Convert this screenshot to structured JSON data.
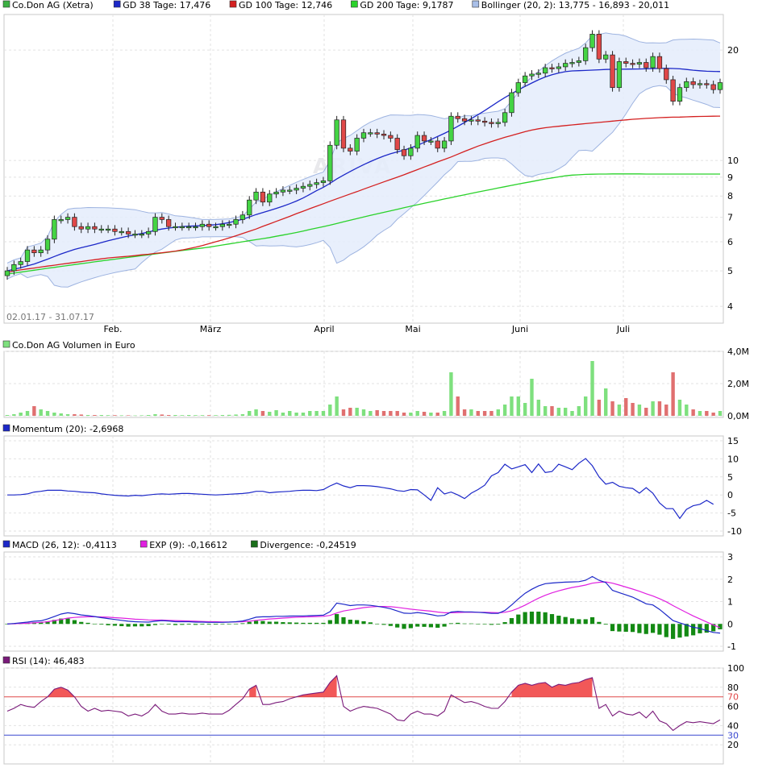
{
  "chart_data": [
    {
      "type": "candlestick",
      "y_scale": "log",
      "ylim": [
        3.6,
        25
      ],
      "y_ticks": [
        "4",
        "5",
        "6",
        "7",
        "8",
        "9",
        "10",
        "20"
      ],
      "x_ticks": [
        "Feb.",
        "März",
        "April",
        "Mai",
        "Juni",
        "Juli"
      ],
      "x_range": "02.01.17 - 31.07.17",
      "watermark": "ARIVA",
      "legend": [
        {
          "label": "Co.Don AG (Xetra)",
          "color": "#3cb043"
        },
        {
          "label": "GD 38 Tage: 17,476",
          "color": "#1c28c8"
        },
        {
          "label": "GD 100 Tage: 12,746",
          "color": "#d42020"
        },
        {
          "label": "GD 200 Tage: 9,1787",
          "color": "#2ad22a"
        },
        {
          "label": "Bollinger (20, 2): 13,775 - 16,893 - 20,011",
          "color": "#a9bfe8"
        }
      ],
      "close": [
        5.0,
        5.2,
        5.3,
        5.7,
        5.6,
        5.7,
        6.1,
        6.9,
        6.9,
        7.0,
        6.6,
        6.5,
        6.6,
        6.5,
        6.5,
        6.5,
        6.4,
        6.4,
        6.3,
        6.3,
        6.3,
        6.4,
        7.0,
        6.9,
        6.6,
        6.6,
        6.6,
        6.6,
        6.6,
        6.7,
        6.6,
        6.6,
        6.7,
        6.7,
        6.9,
        7.1,
        7.8,
        8.2,
        7.7,
        8.1,
        8.2,
        8.3,
        8.3,
        8.4,
        8.5,
        8.6,
        8.7,
        8.8,
        11.0,
        12.9,
        10.8,
        10.6,
        11.5,
        11.9,
        11.9,
        11.8,
        11.7,
        11.5,
        10.7,
        10.3,
        10.8,
        11.7,
        11.3,
        11.3,
        10.8,
        11.3,
        13.2,
        13.0,
        12.8,
        12.9,
        12.8,
        12.7,
        12.6,
        12.7,
        13.5,
        15.3,
        16.3,
        17.0,
        17.2,
        17.3,
        17.9,
        17.8,
        18.0,
        18.4,
        18.5,
        18.7,
        20.3,
        22.1,
        18.9,
        19.4,
        15.8,
        18.6,
        18.4,
        18.3,
        18.5,
        17.9,
        19.2,
        17.8,
        16.6,
        14.5,
        15.8,
        16.4,
        16.1,
        16.2,
        16.1,
        15.6,
        16.3
      ],
      "gd38": [
        5.0,
        5.05,
        5.1,
        5.16,
        5.22,
        5.3,
        5.38,
        5.47,
        5.56,
        5.64,
        5.72,
        5.78,
        5.84,
        5.9,
        5.97,
        6.04,
        6.1,
        6.16,
        6.22,
        6.27,
        6.32,
        6.38,
        6.45,
        6.5,
        6.54,
        6.57,
        6.6,
        6.62,
        6.63,
        6.64,
        6.66,
        6.68,
        6.72,
        6.77,
        6.84,
        6.91,
        7.01,
        7.12,
        7.21,
        7.3,
        7.4,
        7.5,
        7.62,
        7.75,
        7.9,
        8.08,
        8.27,
        8.45,
        8.66,
        8.9,
        9.12,
        9.33,
        9.54,
        9.74,
        9.93,
        10.11,
        10.28,
        10.43,
        10.55,
        10.67,
        10.82,
        11.0,
        11.2,
        11.4,
        11.62,
        11.85,
        12.1,
        12.39,
        12.69,
        13.0,
        13.33,
        13.68,
        14.06,
        14.46,
        14.84,
        15.21,
        15.57,
        15.92,
        16.26,
        16.59,
        16.89,
        17.12,
        17.31,
        17.46,
        17.54,
        17.57,
        17.6,
        17.63,
        17.67,
        17.7,
        17.72,
        17.73,
        17.74,
        17.75,
        17.76,
        17.78,
        17.8,
        17.82,
        17.83,
        17.81,
        17.78,
        17.7,
        17.62,
        17.56,
        17.51,
        17.49,
        17.47
      ],
      "gd100": [
        4.95,
        5.0,
        5.03,
        5.06,
        5.09,
        5.12,
        5.15,
        5.18,
        5.21,
        5.24,
        5.27,
        5.3,
        5.33,
        5.36,
        5.39,
        5.42,
        5.44,
        5.46,
        5.48,
        5.5,
        5.53,
        5.55,
        5.58,
        5.6,
        5.63,
        5.66,
        5.7,
        5.75,
        5.8,
        5.86,
        5.93,
        6.0,
        6.07,
        6.15,
        6.23,
        6.32,
        6.41,
        6.5,
        6.61,
        6.71,
        6.82,
        6.93,
        7.04,
        7.16,
        7.27,
        7.39,
        7.5,
        7.62,
        7.74,
        7.86,
        7.98,
        8.1,
        8.22,
        8.35,
        8.48,
        8.61,
        8.74,
        8.87,
        9.0,
        9.14,
        9.29,
        9.44,
        9.6,
        9.75,
        9.91,
        10.06,
        10.22,
        10.4,
        10.58,
        10.76,
        10.94,
        11.1,
        11.26,
        11.41,
        11.56,
        11.7,
        11.84,
        11.98,
        12.1,
        12.2,
        12.28,
        12.34,
        12.39,
        12.45,
        12.5,
        12.55,
        12.6,
        12.65,
        12.7,
        12.75,
        12.8,
        12.85,
        12.9,
        12.95,
        12.98,
        13.02,
        13.05,
        13.08,
        13.1,
        13.12,
        13.13,
        13.15,
        13.17,
        13.18,
        13.19,
        13.2,
        13.21
      ],
      "gd200": [
        4.9,
        4.93,
        4.96,
        4.99,
        5.02,
        5.05,
        5.08,
        5.11,
        5.14,
        5.17,
        5.2,
        5.23,
        5.26,
        5.29,
        5.32,
        5.35,
        5.38,
        5.41,
        5.44,
        5.47,
        5.5,
        5.53,
        5.56,
        5.59,
        5.62,
        5.65,
        5.68,
        5.71,
        5.74,
        5.77,
        5.8,
        5.84,
        5.88,
        5.92,
        5.96,
        6.0,
        6.04,
        6.08,
        6.12,
        6.16,
        6.21,
        6.26,
        6.31,
        6.36,
        6.42,
        6.48,
        6.54,
        6.6,
        6.66,
        6.73,
        6.8,
        6.87,
        6.94,
        7.01,
        7.08,
        7.15,
        7.22,
        7.29,
        7.36,
        7.43,
        7.5,
        7.57,
        7.64,
        7.71,
        7.78,
        7.85,
        7.92,
        7.99,
        8.06,
        8.13,
        8.2,
        8.27,
        8.34,
        8.41,
        8.48,
        8.55,
        8.62,
        8.69,
        8.76,
        8.83,
        8.9,
        8.96,
        9.02,
        9.08,
        9.12,
        9.14,
        9.16,
        9.17,
        9.18,
        9.18,
        9.19,
        9.19,
        9.19,
        9.19,
        9.19,
        9.18,
        9.18,
        9.18,
        9.18,
        9.18,
        9.18,
        9.18,
        9.18,
        9.18,
        9.18,
        9.18,
        9.18
      ]
    },
    {
      "type": "bar",
      "title": "Co.Don AG Volumen in Euro",
      "y_ticks": [
        "4,0M",
        "2,0M",
        "0,0M"
      ],
      "ylim": [
        0,
        4.0
      ],
      "values": [
        0.05,
        0.1,
        0.2,
        0.3,
        0.6,
        0.4,
        0.3,
        0.2,
        0.15,
        0.1,
        0.1,
        0.08,
        0.05,
        0.05,
        0.05,
        0.04,
        0.04,
        0.03,
        0.03,
        0.02,
        0.03,
        0.05,
        0.1,
        0.08,
        0.05,
        0.05,
        0.04,
        0.05,
        0.04,
        0.04,
        0.04,
        0.04,
        0.05,
        0.06,
        0.08,
        0.1,
        0.3,
        0.4,
        0.3,
        0.25,
        0.35,
        0.2,
        0.3,
        0.2,
        0.2,
        0.3,
        0.3,
        0.3,
        0.7,
        1.2,
        0.4,
        0.5,
        0.5,
        0.4,
        0.3,
        0.35,
        0.3,
        0.3,
        0.3,
        0.2,
        0.2,
        0.3,
        0.25,
        0.2,
        0.2,
        0.3,
        2.7,
        1.2,
        0.4,
        0.4,
        0.3,
        0.3,
        0.3,
        0.4,
        0.7,
        1.2,
        1.2,
        0.8,
        2.3,
        1.0,
        0.6,
        0.6,
        0.5,
        0.5,
        0.3,
        0.6,
        1.2,
        3.4,
        1.0,
        1.7,
        0.9,
        0.7,
        1.1,
        0.8,
        0.7,
        0.5,
        0.9,
        0.9,
        0.7,
        2.7,
        1.0,
        0.7,
        0.4,
        0.3,
        0.3,
        0.2,
        0.3
      ]
    },
    {
      "type": "line",
      "title": "Momentum (20): -2,6968",
      "y_ticks": [
        "15",
        "10",
        "5",
        "0",
        "-5",
        "-10"
      ],
      "ylim": [
        -10,
        15
      ],
      "values": [
        0.0,
        0.0,
        0.1,
        0.3,
        0.8,
        1.0,
        1.3,
        1.3,
        1.3,
        1.1,
        1.0,
        0.8,
        0.7,
        0.6,
        0.3,
        0.1,
        -0.1,
        -0.2,
        -0.3,
        -0.1,
        -0.2,
        0.0,
        0.2,
        0.3,
        0.2,
        0.3,
        0.4,
        0.4,
        0.3,
        0.2,
        0.1,
        0.0,
        0.1,
        0.2,
        0.3,
        0.4,
        0.6,
        1.0,
        1.0,
        0.6,
        0.8,
        0.9,
        1.0,
        1.2,
        1.3,
        1.3,
        1.2,
        1.5,
        2.5,
        3.3,
        2.5,
        2.0,
        2.6,
        2.6,
        2.5,
        2.3,
        2.0,
        1.7,
        1.2,
        1.0,
        1.5,
        1.4,
        0.0,
        -1.5,
        2.0,
        0.3,
        0.8,
        0.0,
        -1.0,
        0.5,
        1.5,
        2.7,
        5.3,
        6.2,
        8.5,
        7.2,
        7.8,
        8.4,
        6.2,
        8.6,
        6.2,
        6.5,
        8.5,
        7.8,
        7.0,
        8.8,
        10.1,
        8.1,
        5.0,
        3.0,
        3.5,
        2.4,
        2.0,
        1.8,
        0.5,
        2.0,
        0.5,
        -2.2,
        -3.8,
        -3.8,
        -6.5,
        -4.0,
        -3.0,
        -2.6,
        -1.5,
        -2.6
      ]
    },
    {
      "type": "line",
      "y_ticks": [
        "3",
        "2",
        "1",
        "0",
        "-1"
      ],
      "ylim": [
        -1,
        3
      ],
      "legend": [
        {
          "label": "MACD (26, 12): -0,4113",
          "color": "#1c28c8"
        },
        {
          "label": "EXP (9): -0,16612",
          "color": "#e020e0"
        },
        {
          "label": "Divergence: -0,24519",
          "color": "#1a6e1a"
        }
      ],
      "macd": [
        0.0,
        0.02,
        0.05,
        0.08,
        0.12,
        0.14,
        0.22,
        0.33,
        0.44,
        0.5,
        0.46,
        0.4,
        0.37,
        0.33,
        0.28,
        0.24,
        0.2,
        0.16,
        0.12,
        0.1,
        0.09,
        0.08,
        0.12,
        0.15,
        0.13,
        0.1,
        0.1,
        0.1,
        0.08,
        0.08,
        0.07,
        0.07,
        0.07,
        0.08,
        0.1,
        0.13,
        0.21,
        0.3,
        0.32,
        0.32,
        0.34,
        0.34,
        0.35,
        0.36,
        0.36,
        0.37,
        0.38,
        0.39,
        0.55,
        0.93,
        0.88,
        0.82,
        0.85,
        0.85,
        0.83,
        0.79,
        0.74,
        0.68,
        0.58,
        0.48,
        0.47,
        0.51,
        0.47,
        0.42,
        0.36,
        0.38,
        0.53,
        0.56,
        0.54,
        0.54,
        0.52,
        0.5,
        0.47,
        0.47,
        0.6,
        0.85,
        1.12,
        1.37,
        1.55,
        1.7,
        1.8,
        1.83,
        1.85,
        1.87,
        1.88,
        1.89,
        1.95,
        2.12,
        1.95,
        1.85,
        1.5,
        1.4,
        1.3,
        1.2,
        1.05,
        0.9,
        0.85,
        0.65,
        0.4,
        0.15,
        0.05,
        -0.05,
        -0.15,
        -0.2,
        -0.3,
        -0.38,
        -0.41
      ],
      "exp": [
        0.0,
        0.01,
        0.02,
        0.03,
        0.05,
        0.07,
        0.1,
        0.15,
        0.2,
        0.26,
        0.29,
        0.31,
        0.32,
        0.32,
        0.31,
        0.3,
        0.28,
        0.26,
        0.24,
        0.21,
        0.2,
        0.18,
        0.17,
        0.17,
        0.16,
        0.15,
        0.14,
        0.13,
        0.12,
        0.11,
        0.1,
        0.1,
        0.09,
        0.09,
        0.09,
        0.1,
        0.12,
        0.16,
        0.19,
        0.22,
        0.24,
        0.26,
        0.28,
        0.3,
        0.31,
        0.32,
        0.33,
        0.34,
        0.38,
        0.49,
        0.58,
        0.63,
        0.68,
        0.73,
        0.76,
        0.78,
        0.78,
        0.77,
        0.74,
        0.7,
        0.66,
        0.63,
        0.6,
        0.57,
        0.53,
        0.5,
        0.5,
        0.51,
        0.52,
        0.52,
        0.52,
        0.52,
        0.51,
        0.5,
        0.52,
        0.59,
        0.7,
        0.84,
        1.0,
        1.15,
        1.28,
        1.39,
        1.48,
        1.56,
        1.63,
        1.68,
        1.74,
        1.82,
        1.86,
        1.88,
        1.82,
        1.74,
        1.65,
        1.56,
        1.46,
        1.35,
        1.25,
        1.13,
        0.99,
        0.82,
        0.66,
        0.51,
        0.36,
        0.22,
        0.09,
        -0.05,
        -0.17
      ]
    },
    {
      "type": "line",
      "title": "RSI (14): 46,483",
      "y_ticks": [
        "100",
        "80",
        "70",
        "60",
        "40",
        "30",
        "20"
      ],
      "ylim": [
        0,
        100
      ],
      "ref_lines": [
        70,
        30
      ],
      "values": [
        55,
        58,
        62,
        60,
        59,
        65,
        70,
        78,
        80,
        77,
        70,
        60,
        55,
        58,
        55,
        56,
        55,
        54,
        50,
        52,
        50,
        54,
        62,
        55,
        52,
        52,
        53,
        52,
        52,
        53,
        52,
        52,
        52,
        56,
        62,
        68,
        78,
        82,
        62,
        62,
        64,
        65,
        68,
        70,
        72,
        73,
        74,
        75,
        85,
        92,
        60,
        55,
        58,
        60,
        59,
        58,
        55,
        52,
        46,
        45,
        52,
        55,
        52,
        52,
        50,
        55,
        72,
        68,
        64,
        65,
        63,
        60,
        58,
        58,
        65,
        75,
        82,
        84,
        82,
        84,
        85,
        80,
        83,
        82,
        84,
        85,
        88,
        90,
        58,
        62,
        50,
        55,
        52,
        51,
        54,
        48,
        55,
        45,
        42,
        35,
        40,
        44,
        43,
        44,
        43,
        42,
        46
      ]
    }
  ]
}
